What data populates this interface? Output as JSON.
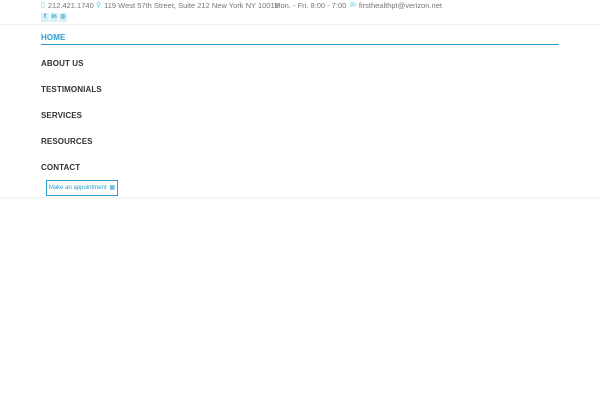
{
  "topbar": {
    "phone": "212.421.1740",
    "address": "119 West 57th Street, Suite 212 New York NY 10019",
    "hours": "Mon. - Fri. 8:00 - 7:00",
    "email": "firsthealthpt@verizon.net"
  },
  "social": [
    "f",
    "in",
    "◎"
  ],
  "nav": {
    "items": [
      {
        "label": "HOME",
        "active": true
      },
      {
        "label": "ABOUT US"
      },
      {
        "label": "TESTIMONIALS"
      },
      {
        "label": "SERVICES"
      },
      {
        "label": "RESOURCES"
      },
      {
        "label": "CONTACT"
      }
    ]
  },
  "cta": {
    "label": "Make an appointment"
  },
  "colors": {
    "accent": "#2a9fd0",
    "icon": "#5cc6e3",
    "text": "#333333"
  }
}
